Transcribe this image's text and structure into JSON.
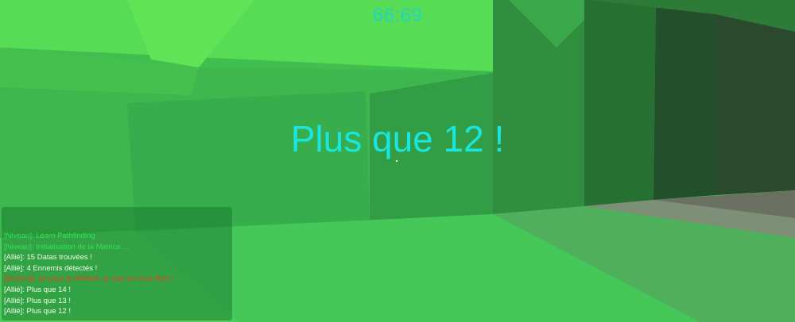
{
  "hud": {
    "timer": "66:69",
    "center_message": "Plus que 12 !"
  },
  "log": {
    "lines": [
      {
        "text": "[Niveau]: Learn Pathfinding",
        "color": "#2fe35a"
      },
      {
        "text": "[Niveau]: Initialisation de la Matrice ...",
        "color": "#2fe35a"
      },
      {
        "text": "[Allié]: 15 Datas trouvées !",
        "color": "#e9ffe9"
      },
      {
        "text": "[Allié]: 4 Ennemis détectés !",
        "color": "#e9ffe9"
      },
      {
        "text": "[Ennemi]: Je vous ai détecté, je sais où vous êtes !",
        "color": "#e8401f"
      },
      {
        "text": "[Allié]: Plus que 14 !",
        "color": "#e9ffe9"
      },
      {
        "text": "[Allié]: Plus que 13 !",
        "color": "#e9ffe9"
      },
      {
        "text": "[Allié]: Plus que 12 !",
        "color": "#e9ffe9"
      }
    ]
  },
  "colors": {
    "timer": "#1fd6c0",
    "center_message": "#18e6e0",
    "floor": "#45c85a",
    "wall": "#37a24a"
  }
}
